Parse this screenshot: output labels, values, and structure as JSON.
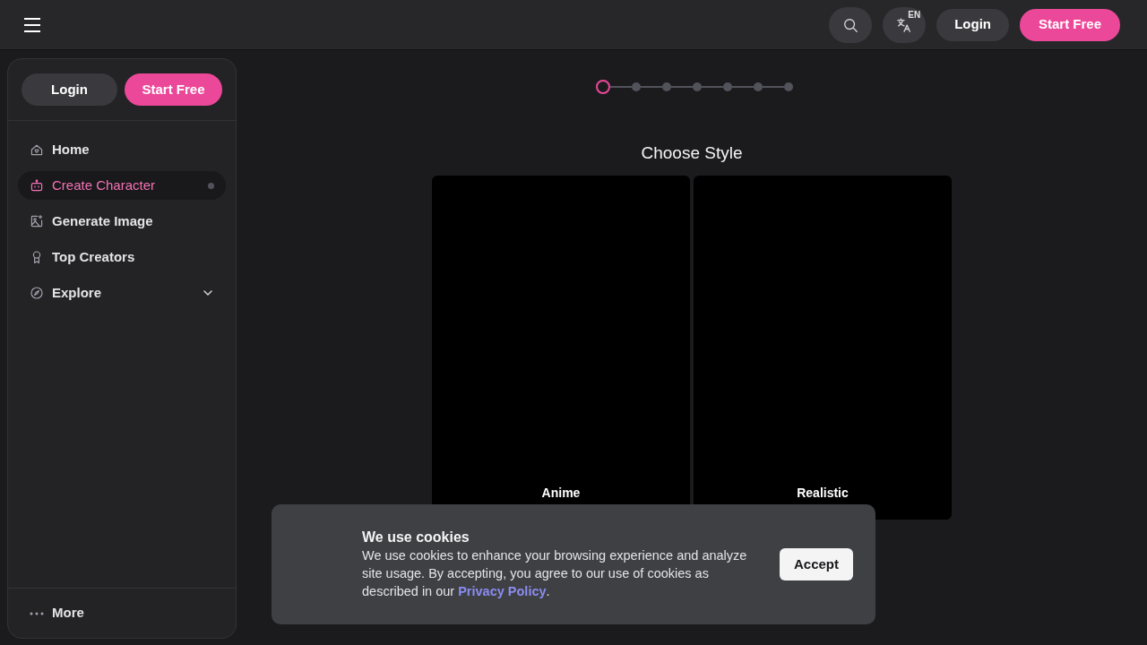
{
  "header": {
    "language_badge": "EN",
    "login": "Login",
    "start_free": "Start Free"
  },
  "sidebar": {
    "login": "Login",
    "start_free": "Start Free",
    "items": [
      {
        "kind": "home",
        "label": "Home",
        "selected": false
      },
      {
        "kind": "robot",
        "label": "Create Character",
        "selected": true
      },
      {
        "kind": "image",
        "label": "Generate Image",
        "selected": false
      },
      {
        "kind": "award",
        "label": "Top Creators",
        "selected": false
      },
      {
        "kind": "compass",
        "label": "Explore",
        "selected": false,
        "expanded": false
      }
    ],
    "more": "More"
  },
  "steps": [
    {
      "selected": true
    },
    {
      "selected": false
    },
    {
      "selected": false
    },
    {
      "selected": false
    },
    {
      "selected": false
    },
    {
      "selected": false
    },
    {
      "selected": false
    }
  ],
  "title": "Choose Style",
  "styles": [
    {
      "label": "Anime"
    },
    {
      "label": "Realistic"
    }
  ],
  "cookie_banner": {
    "title": "We use cookies",
    "text": "We use cookies to enhance your browsing experience and analyze site usage. By accepting, you agree to our use of cookies as described in our",
    "link": "Privacy Policy",
    "after_link": ".",
    "button": "Accept"
  }
}
